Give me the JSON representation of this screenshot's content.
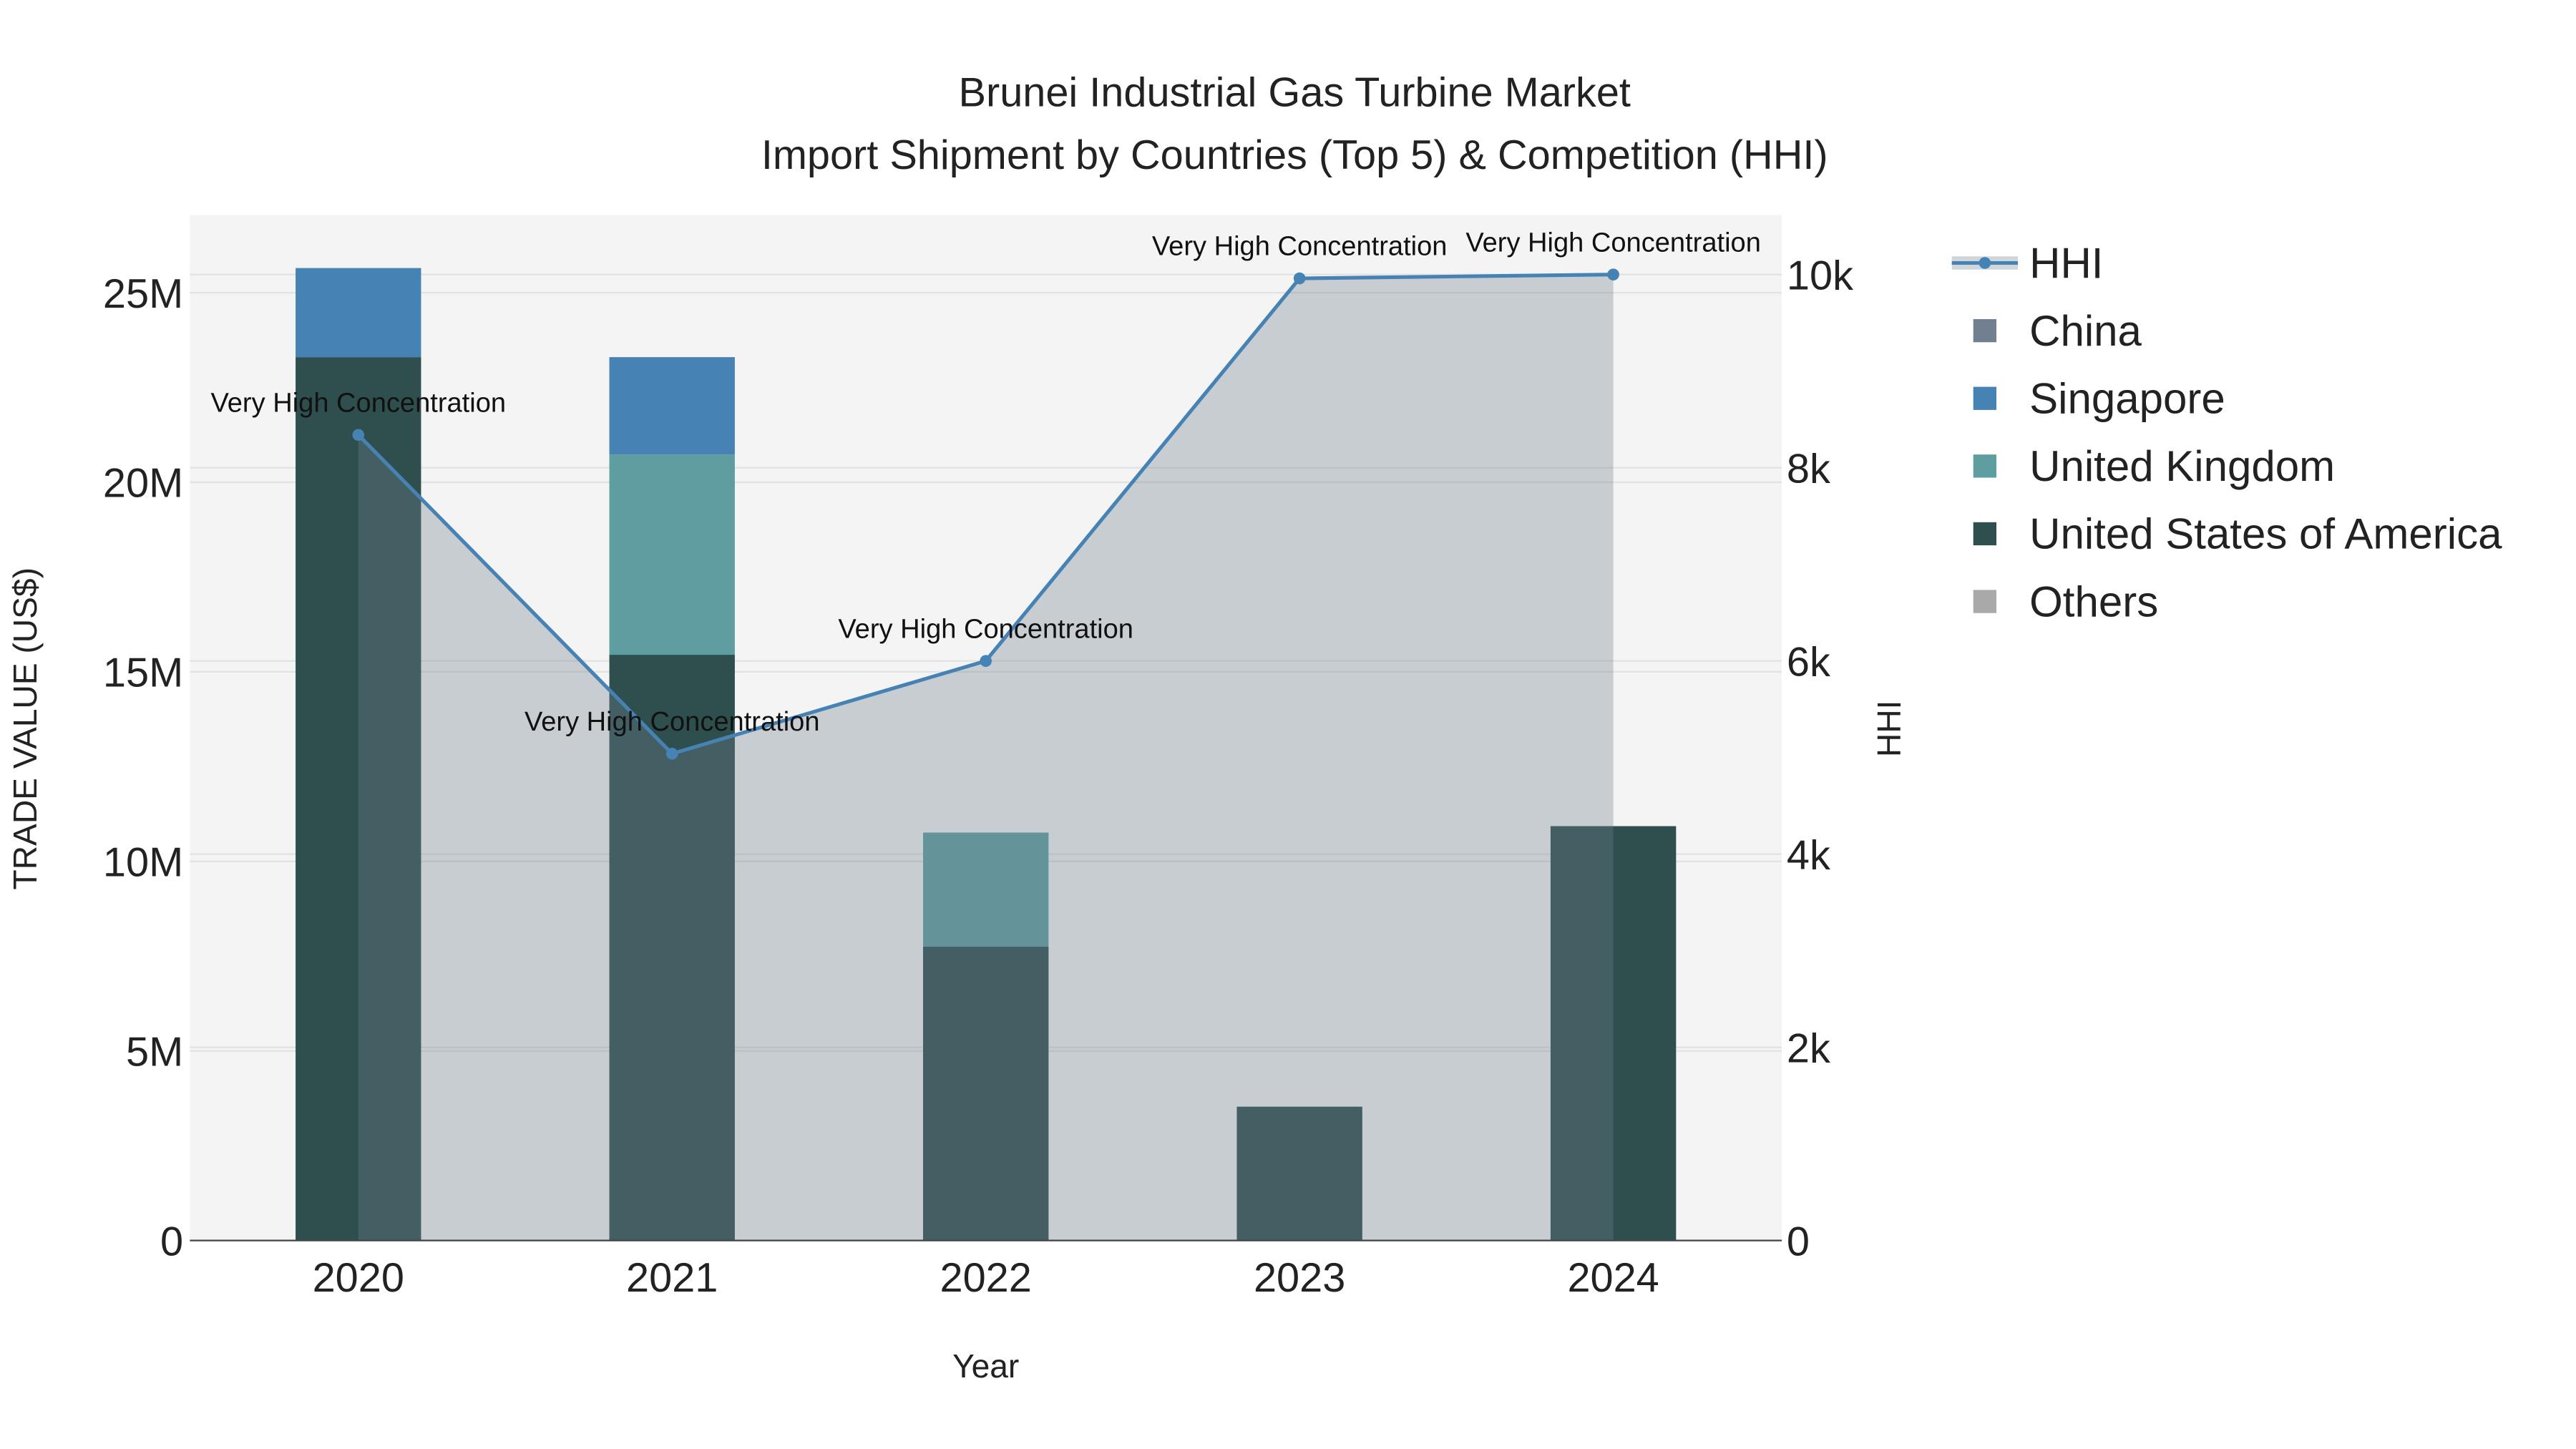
{
  "chart_data": {
    "type": "bar",
    "title": "Brunei Industrial Gas Turbine Market",
    "subtitle": "Import Shipment by Countries (Top 5) & Competition (HHI)",
    "xlabel": "Year",
    "ylabel": "TRADE VALUE (US$)",
    "y2label": "HHI",
    "categories": [
      "2020",
      "2021",
      "2022",
      "2023",
      "2024"
    ],
    "ylim": [
      0,
      27000000
    ],
    "y2lim": [
      0,
      10600
    ],
    "yticks": [
      {
        "v": 0,
        "label": "0"
      },
      {
        "v": 5000000,
        "label": "5M"
      },
      {
        "v": 10000000,
        "label": "10M"
      },
      {
        "v": 15000000,
        "label": "15M"
      },
      {
        "v": 20000000,
        "label": "20M"
      },
      {
        "v": 25000000,
        "label": "25M"
      }
    ],
    "y2ticks": [
      {
        "v": 0,
        "label": "0"
      },
      {
        "v": 2000,
        "label": "2k"
      },
      {
        "v": 4000,
        "label": "4k"
      },
      {
        "v": 6000,
        "label": "6k"
      },
      {
        "v": 8000,
        "label": "8k"
      },
      {
        "v": 10000,
        "label": "10k"
      }
    ],
    "barmode": "stack",
    "series": [
      {
        "name": "United States of America",
        "color": "#2F4F4F",
        "values": [
          23300000,
          15450000,
          7750000,
          3530000,
          10930000
        ]
      },
      {
        "name": "United Kingdom",
        "color": "#5F9EA0",
        "values": [
          0,
          5280000,
          3010000,
          0,
          0
        ]
      },
      {
        "name": "Singapore",
        "color": "#4682B4",
        "values": [
          2350000,
          2570000,
          0,
          0,
          0
        ]
      },
      {
        "name": "China",
        "color": "#708090",
        "values": [
          0,
          0,
          0,
          0,
          0
        ]
      },
      {
        "name": "Others",
        "color": "#A9A9A9",
        "values": [
          0,
          0,
          0,
          0,
          0
        ]
      }
    ],
    "hhi": {
      "name": "HHI",
      "color": "#4682B4",
      "values": [
        8340,
        5040,
        6000,
        9960,
        10000
      ],
      "labels": [
        "Very High Concentration",
        "Very High Concentration",
        "Very High Concentration",
        "Very High Concentration",
        "Very High Concentration"
      ]
    },
    "legend": [
      "HHI",
      "China",
      "Singapore",
      "United Kingdom",
      "United States of America",
      "Others"
    ],
    "legend_position": "right",
    "grid": true
  }
}
